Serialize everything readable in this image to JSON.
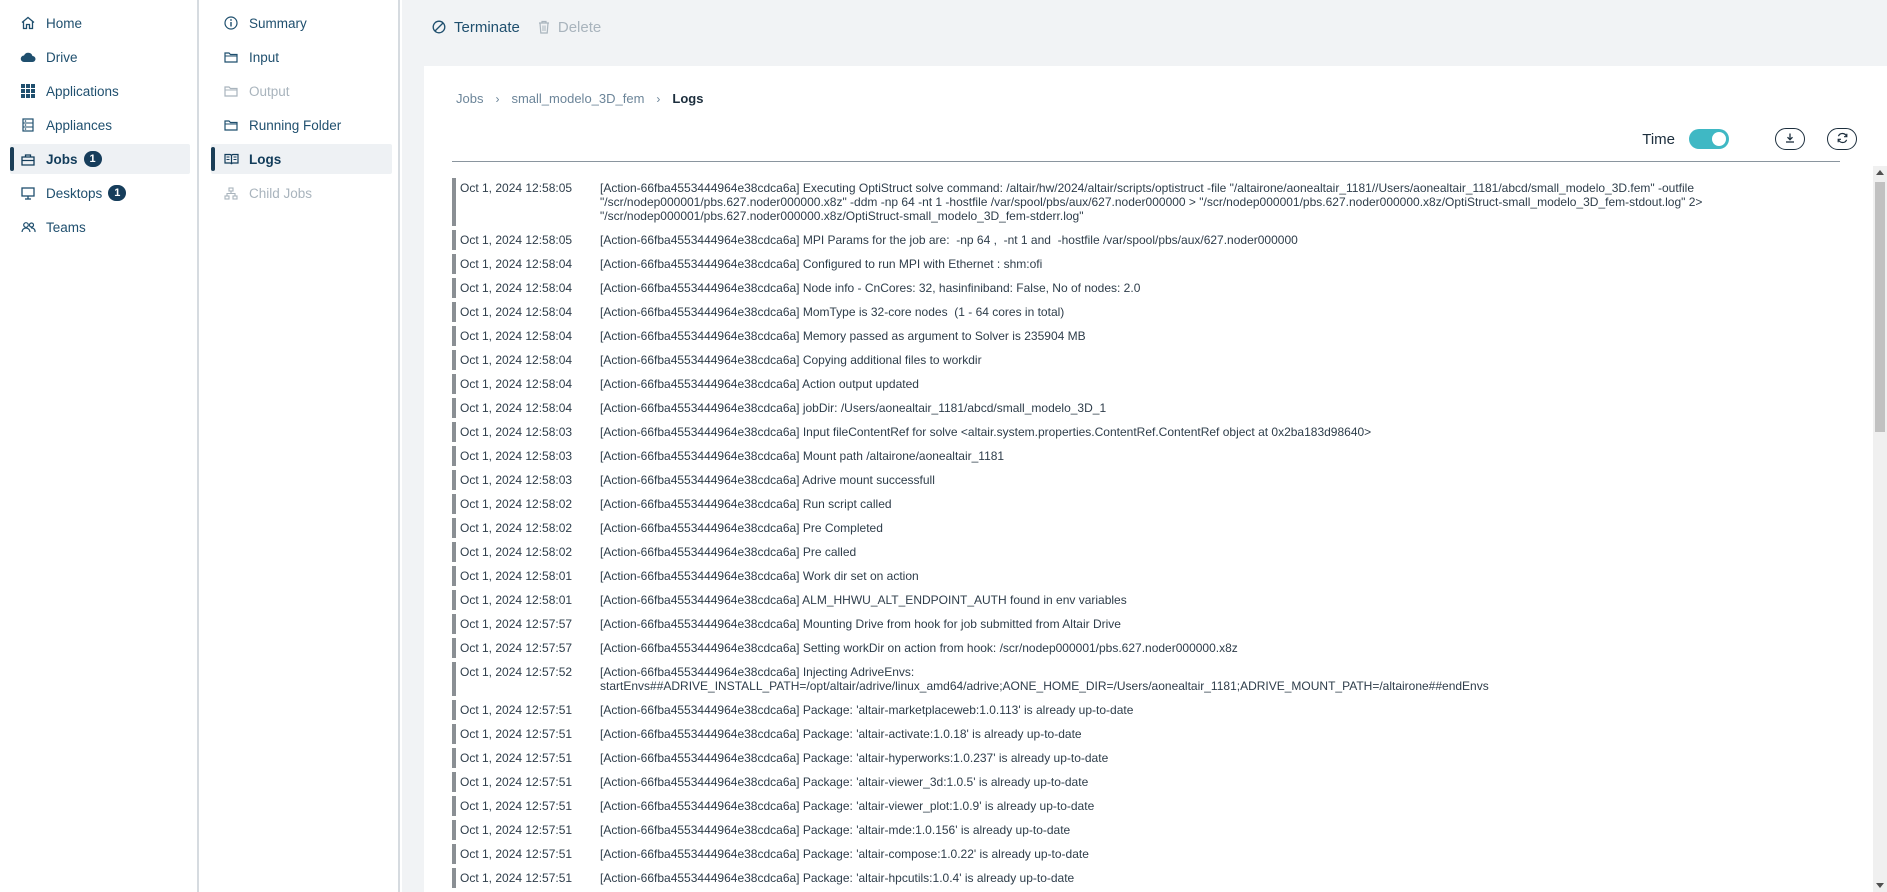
{
  "nav": {
    "items": [
      {
        "label": "Home",
        "icon": "home-icon"
      },
      {
        "label": "Drive",
        "icon": "cloud-icon"
      },
      {
        "label": "Applications",
        "icon": "grid-icon"
      },
      {
        "label": "Appliances",
        "icon": "appliance-icon"
      },
      {
        "label": "Jobs",
        "icon": "jobs-icon",
        "badge": "1",
        "active": true
      },
      {
        "label": "Desktops",
        "icon": "monitor-icon",
        "badge": "1"
      },
      {
        "label": "Teams",
        "icon": "users-icon"
      }
    ]
  },
  "subnav": {
    "items": [
      {
        "label": "Summary",
        "icon": "info-icon"
      },
      {
        "label": "Input",
        "icon": "folder-icon"
      },
      {
        "label": "Output",
        "icon": "folder-icon",
        "disabled": true
      },
      {
        "label": "Running Folder",
        "icon": "folder-icon"
      },
      {
        "label": "Logs",
        "icon": "book-icon",
        "active": true
      },
      {
        "label": "Child Jobs",
        "icon": "hierarchy-icon",
        "disabled": true
      }
    ]
  },
  "toolbar": {
    "terminate_label": "Terminate",
    "delete_label": "Delete"
  },
  "breadcrumb": {
    "items": [
      "Jobs",
      "small_modelo_3D_fem",
      "Logs"
    ]
  },
  "controls": {
    "time_label": "Time",
    "time_enabled": true
  },
  "colors": {
    "accent": "#3fb8c4",
    "nav_dark": "#163d5b",
    "disabled": "#a9b4bd"
  },
  "logs": [
    {
      "t": "Oct 1, 2024 12:58:05",
      "m": "[Action-66fba4553444964e38cdca6a] Executing OptiStruct solve command: /altair/hw/2024/altair/scripts/optistruct -file \"/altairone/aonealtair_1181//Users/aonealtair_1181/abcd/small_modelo_3D.fem\" -outfile \"/scr/nodep000001/pbs.627.noder000000.x8z\" -ddm -np 64 -nt 1 -hostfile /var/spool/pbs/aux/627.noder000000 > \"/scr/nodep000001/pbs.627.noder000000.x8z/OptiStruct-small_modelo_3D_fem-stdout.log\" 2> \"/scr/nodep000001/pbs.627.noder000000.x8z/OptiStruct-small_modelo_3D_fem-stderr.log\""
    },
    {
      "t": "Oct 1, 2024 12:58:05",
      "m": "[Action-66fba4553444964e38cdca6a] MPI Params for the job are:  -np 64 ,  -nt 1 and  -hostfile /var/spool/pbs/aux/627.noder000000"
    },
    {
      "t": "Oct 1, 2024 12:58:04",
      "m": "[Action-66fba4553444964e38cdca6a] Configured to run MPI with Ethernet : shm:ofi"
    },
    {
      "t": "Oct 1, 2024 12:58:04",
      "m": "[Action-66fba4553444964e38cdca6a] Node info - CnCores: 32, hasinfiniband: False, No of nodes: 2.0"
    },
    {
      "t": "Oct 1, 2024 12:58:04",
      "m": "[Action-66fba4553444964e38cdca6a] MomType is 32-core nodes  (1 - 64 cores in total)"
    },
    {
      "t": "Oct 1, 2024 12:58:04",
      "m": "[Action-66fba4553444964e38cdca6a] Memory passed as argument to Solver is 235904 MB"
    },
    {
      "t": "Oct 1, 2024 12:58:04",
      "m": "[Action-66fba4553444964e38cdca6a] Copying additional files to workdir"
    },
    {
      "t": "Oct 1, 2024 12:58:04",
      "m": "[Action-66fba4553444964e38cdca6a] Action output updated"
    },
    {
      "t": "Oct 1, 2024 12:58:04",
      "m": "[Action-66fba4553444964e38cdca6a] jobDir: /Users/aonealtair_1181/abcd/small_modelo_3D_1"
    },
    {
      "t": "Oct 1, 2024 12:58:03",
      "m": "[Action-66fba4553444964e38cdca6a] Input fileContentRef for solve <altair.system.properties.ContentRef.ContentRef object at 0x2ba183d98640>"
    },
    {
      "t": "Oct 1, 2024 12:58:03",
      "m": "[Action-66fba4553444964e38cdca6a] Mount path /altairone/aonealtair_1181"
    },
    {
      "t": "Oct 1, 2024 12:58:03",
      "m": "[Action-66fba4553444964e38cdca6a] Adrive mount successfull"
    },
    {
      "t": "Oct 1, 2024 12:58:02",
      "m": "[Action-66fba4553444964e38cdca6a] Run script called"
    },
    {
      "t": "Oct 1, 2024 12:58:02",
      "m": "[Action-66fba4553444964e38cdca6a] Pre Completed"
    },
    {
      "t": "Oct 1, 2024 12:58:02",
      "m": "[Action-66fba4553444964e38cdca6a] Pre called"
    },
    {
      "t": "Oct 1, 2024 12:58:01",
      "m": "[Action-66fba4553444964e38cdca6a] Work dir set on action"
    },
    {
      "t": "Oct 1, 2024 12:58:01",
      "m": "[Action-66fba4553444964e38cdca6a] ALM_HHWU_ALT_ENDPOINT_AUTH found in env variables"
    },
    {
      "t": "Oct 1, 2024 12:57:57",
      "m": "[Action-66fba4553444964e38cdca6a] Mounting Drive from hook for job submitted from Altair Drive"
    },
    {
      "t": "Oct 1, 2024 12:57:57",
      "m": "[Action-66fba4553444964e38cdca6a] Setting workDir on action from hook: /scr/nodep000001/pbs.627.noder000000.x8z"
    },
    {
      "t": "Oct 1, 2024 12:57:52",
      "m": "[Action-66fba4553444964e38cdca6a] Injecting AdriveEnvs:\nstartEnvs##ADRIVE_INSTALL_PATH=/opt/altair/adrive/linux_amd64/adrive;AONE_HOME_DIR=/Users/aonealtair_1181;ADRIVE_MOUNT_PATH=/altairone##endEnvs"
    },
    {
      "t": "Oct 1, 2024 12:57:51",
      "m": "[Action-66fba4553444964e38cdca6a] Package: 'altair-marketplaceweb:1.0.113' is already up-to-date"
    },
    {
      "t": "Oct 1, 2024 12:57:51",
      "m": "[Action-66fba4553444964e38cdca6a] Package: 'altair-activate:1.0.18' is already up-to-date"
    },
    {
      "t": "Oct 1, 2024 12:57:51",
      "m": "[Action-66fba4553444964e38cdca6a] Package: 'altair-hyperworks:1.0.237' is already up-to-date"
    },
    {
      "t": "Oct 1, 2024 12:57:51",
      "m": "[Action-66fba4553444964e38cdca6a] Package: 'altair-viewer_3d:1.0.5' is already up-to-date"
    },
    {
      "t": "Oct 1, 2024 12:57:51",
      "m": "[Action-66fba4553444964e38cdca6a] Package: 'altair-viewer_plot:1.0.9' is already up-to-date"
    },
    {
      "t": "Oct 1, 2024 12:57:51",
      "m": "[Action-66fba4553444964e38cdca6a] Package: 'altair-mde:1.0.156' is already up-to-date"
    },
    {
      "t": "Oct 1, 2024 12:57:51",
      "m": "[Action-66fba4553444964e38cdca6a] Package: 'altair-compose:1.0.22' is already up-to-date"
    },
    {
      "t": "Oct 1, 2024 12:57:51",
      "m": "[Action-66fba4553444964e38cdca6a] Package: 'altair-hpcutils:1.0.4' is already up-to-date"
    }
  ]
}
